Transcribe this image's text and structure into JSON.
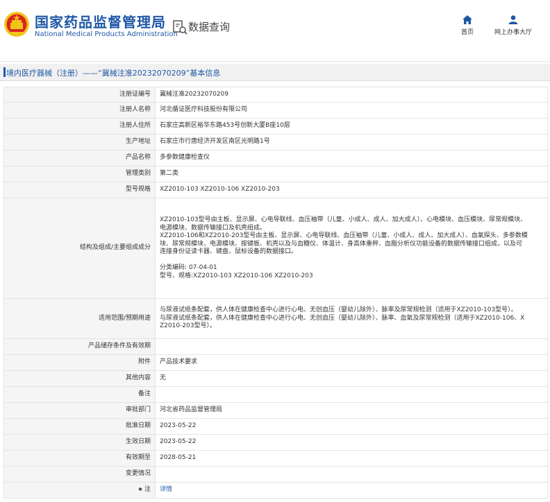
{
  "header": {
    "brand_cn": "国家药品监督管理局",
    "brand_en": "National Medical Products Administration",
    "search_label": "数据查询",
    "nav": [
      {
        "label": "首页",
        "icon": "home-icon"
      },
      {
        "label": "网上办事大厅",
        "icon": "user-icon"
      }
    ],
    "colors": {
      "brand": "#1f57a6",
      "emblem_red": "#d8261e",
      "emblem_gold": "#f2c318"
    }
  },
  "breadcrumb": "境内医疗器械（注册）——“冀械注准20232070209”基本信息",
  "rows": [
    {
      "label": "注册证编号",
      "value": "冀械注准20232070209"
    },
    {
      "label": "注册人名称",
      "value": "河北循证医疗科技股份有限公司"
    },
    {
      "label": "注册人住所",
      "value": "石家庄高新区裕华东路453号创新大厦B座10层"
    },
    {
      "label": "生产地址",
      "value": "石家庄市行唐经济开发区南区光明路1号"
    },
    {
      "label": "产品名称",
      "value": "多参数健康检查仪"
    },
    {
      "label": "管理类别",
      "value": "第二类"
    },
    {
      "label": "型号规格",
      "value": "XZ2010-103 XZ2010-106 XZ2010-203"
    },
    {
      "label": "结构及组成/主要组成成分",
      "lines": [
        "XZ2010-103型号由主板、显示屏、心电导联线、血压袖带（儿童、小成人、成人、加大成人）、心电模块、血压模块、尿常规模块、",
        "电源模块、数据传输接口及机壳组成。",
        "XZ2010-106和XZ2010-203型号由主板、显示屏、心电导联线、血压袖带（儿童、小成人、成人、加大成人）、血氧探头、多参数模",
        "块、尿常规模块、电源模块、按键板、机壳以及与血糖仪、体温计、身高体重秤、血脂分析仪功能设备的数据传输接口组成，以及可",
        "连接身份证读卡器、键盘、鼠标设备的数据接口。",
        "",
        "分类编码: 07-04-01",
        "型号、规格:XZ2010-103 XZ2010-106 XZ2010-203"
      ]
    },
    {
      "label": "适用范围/预期用途",
      "lines": [
        "与尿液试纸条配套，供人体在健康检查中心进行心电、无创血压（婴幼儿除外）、脉率及尿常规检测（适用于XZ2010-103型号）。",
        "与尿液试纸条配套，供人体在健康检查中心进行心电、无创血压（婴幼儿除外）、脉率、血氧及尿常规检测（适用于XZ2010-106、X",
        "Z2010-203型号）。"
      ]
    },
    {
      "label": "产品储存条件及有效期",
      "value": ""
    },
    {
      "label": "附件",
      "value": "产品技术要求"
    },
    {
      "label": "其他内容",
      "value": "无"
    },
    {
      "label": "备注",
      "value": ""
    },
    {
      "label": "审批部门",
      "value": "河北省药品监督管理局"
    },
    {
      "label": "批准日期",
      "value": "2023-05-22"
    },
    {
      "label": "生效日期",
      "value": "2023-05-22"
    },
    {
      "label": "有效期至",
      "value": "2028-05-21"
    },
    {
      "label": "变更情况",
      "value": ""
    },
    {
      "label": "注",
      "value": "详情",
      "is_link": true,
      "icon": "asterisk-icon"
    }
  ]
}
